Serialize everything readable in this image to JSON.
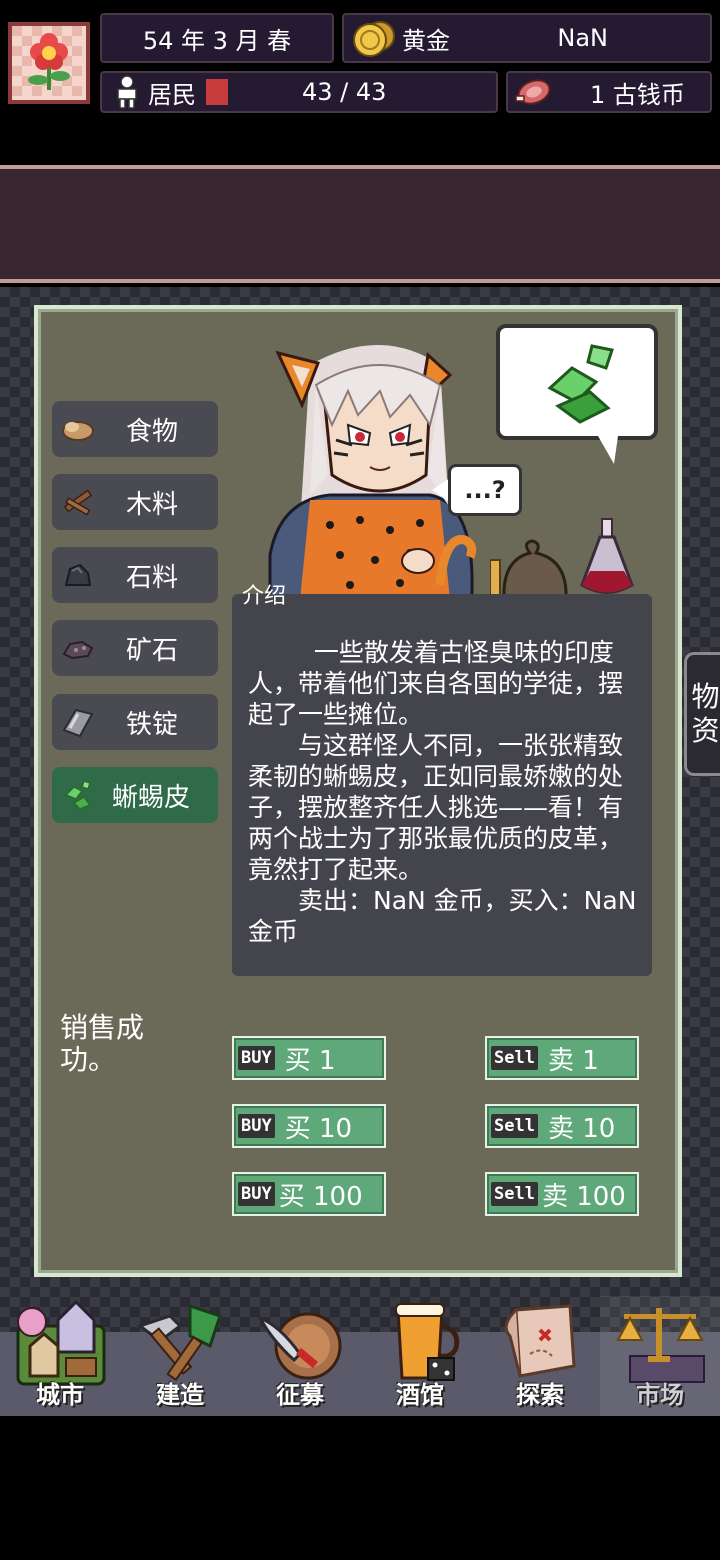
{
  "header": {
    "date": "54 年 3 月 春",
    "gold_label": "黄金",
    "gold_value": "NaN",
    "population_label": "居民",
    "population_value": "43 / 43",
    "coins": "1 古钱币"
  },
  "categories": [
    {
      "label": "食物",
      "icon": "food-icon"
    },
    {
      "label": "木料",
      "icon": "wood-icon"
    },
    {
      "label": "石料",
      "icon": "stone-icon"
    },
    {
      "label": "矿石",
      "icon": "ore-icon"
    },
    {
      "label": "铁锭",
      "icon": "iron-ingot-icon"
    },
    {
      "label": "蜥蜴皮",
      "icon": "lizard-skin-icon",
      "active": true
    }
  ],
  "speech": {
    "question": "...?"
  },
  "description": {
    "label": "介绍",
    "text": "　　一些散发着古怪臭味的印度人，带着他们来自各国的学徒，摆起了一些摊位。\n　　与这群怪人不同，一张张精致柔韧的蜥蜴皮，正如同最娇嫩的处子，摆放整齐任人挑选——看！有两个战士为了那张最优质的皮革，竟然打了起来。\n　　卖出：NaN 金币，买入：NaN 金币"
  },
  "side_tab": {
    "line1": "物",
    "line2": "资"
  },
  "status_message": "销售成功。",
  "trade": {
    "buy_tag": "BUY",
    "sell_tag": "Sell",
    "buy": [
      "买 1",
      "买 10",
      "买 100"
    ],
    "sell": [
      "卖 1",
      "卖 10",
      "卖 100"
    ]
  },
  "nav": [
    {
      "label": "城市",
      "icon": "city-icon"
    },
    {
      "label": "建造",
      "icon": "build-icon"
    },
    {
      "label": "征募",
      "icon": "recruit-icon"
    },
    {
      "label": "酒馆",
      "icon": "tavern-icon"
    },
    {
      "label": "探索",
      "icon": "explore-icon"
    },
    {
      "label": "市场",
      "icon": "market-icon",
      "active": true
    }
  ],
  "colors": {
    "panel": "#6b6a58",
    "active_category": "#2f6b48",
    "trade_button": "#5ea87a",
    "header_bg": "#3a2630"
  }
}
